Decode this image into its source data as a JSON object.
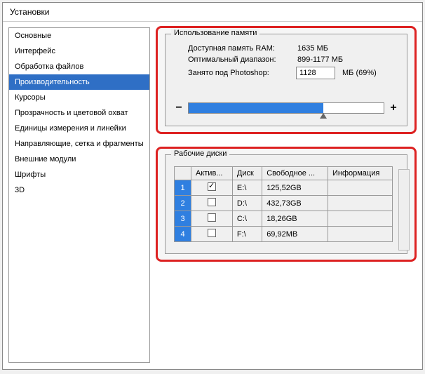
{
  "window": {
    "title": "Установки"
  },
  "sidebar": {
    "items": [
      {
        "label": "Основные"
      },
      {
        "label": "Интерфейс"
      },
      {
        "label": "Обработка файлов"
      },
      {
        "label": "Производительность"
      },
      {
        "label": "Курсоры"
      },
      {
        "label": "Прозрачность и цветовой охват"
      },
      {
        "label": "Единицы измерения и линейки"
      },
      {
        "label": "Направляющие, сетка и фрагменты"
      },
      {
        "label": "Внешние модули"
      },
      {
        "label": "Шрифты"
      },
      {
        "label": "3D"
      }
    ],
    "selected": 3
  },
  "memory": {
    "group_title": "Использование памяти",
    "available_label": "Доступная память RAM:",
    "available_value": "1635 МБ",
    "range_label": "Оптимальный диапазон:",
    "range_value": "899-1177 МБ",
    "used_label": "Занято под Photoshop:",
    "used_value": "1128",
    "used_suffix": "МБ (69%)",
    "minus": "−",
    "plus": "+",
    "percent": 69
  },
  "disks": {
    "group_title": "Рабочие диски",
    "headers": {
      "active": "Актив...",
      "disk": "Диск",
      "free": "Свободное ...",
      "info": "Информация"
    },
    "rows": [
      {
        "n": "1",
        "active": true,
        "disk": "E:\\",
        "free": "125,52GB",
        "info": ""
      },
      {
        "n": "2",
        "active": false,
        "disk": "D:\\",
        "free": "432,73GB",
        "info": ""
      },
      {
        "n": "3",
        "active": false,
        "disk": "C:\\",
        "free": "18,26GB",
        "info": ""
      },
      {
        "n": "4",
        "active": false,
        "disk": "F:\\",
        "free": "69,92MB",
        "info": ""
      }
    ]
  }
}
